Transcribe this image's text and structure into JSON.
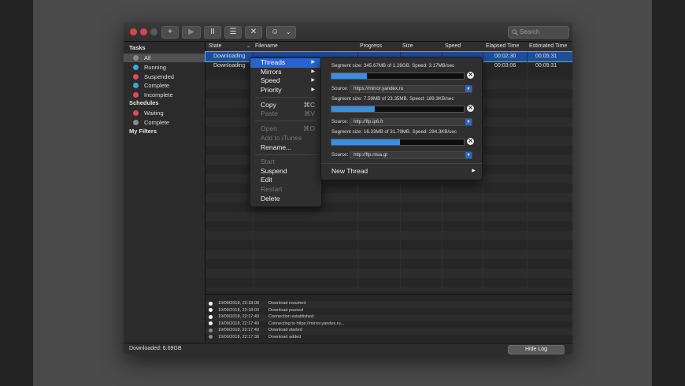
{
  "toolbar": {
    "add_label": "+",
    "play_label": "▶",
    "pause_label": "II",
    "list_label": "☰",
    "delete_label": "✕",
    "speed_label": "☺",
    "speed_arrow": "⌄",
    "search_placeholder": "Search"
  },
  "sidebar": {
    "tasks_heading": "Tasks",
    "tasks": [
      {
        "label": "All",
        "color": "#8a8a8a"
      },
      {
        "label": "Running",
        "color": "#3aa5e6"
      },
      {
        "label": "Suspended",
        "color": "#e04a5a"
      },
      {
        "label": "Complete",
        "color": "#3aa5e6"
      },
      {
        "label": "Incomplete",
        "color": "#e04a5a"
      }
    ],
    "schedules_heading": "Schedules",
    "schedules": [
      {
        "label": "Waiting",
        "color": "#e04a5a"
      },
      {
        "label": "Complete",
        "color": "#8a8a8a"
      }
    ],
    "filters_heading": "My Filters"
  },
  "table": {
    "columns": [
      "State",
      "Filename",
      "Progress",
      "Size",
      "Speed",
      "Elapsed Time",
      "Estimated Time"
    ],
    "rows": [
      {
        "state": "Downloading",
        "elapsed": "00:02:30",
        "estimated": "00:05:31"
      },
      {
        "state": "Downloading",
        "elapsed": "00:03:06",
        "estimated": "00:09:31"
      }
    ]
  },
  "context_menu": {
    "items": [
      {
        "label": "Threads",
        "arrow": "▶"
      },
      {
        "label": "Mirrors",
        "arrow": "▶"
      },
      {
        "label": "Speed",
        "arrow": "▶"
      },
      {
        "label": "Priority",
        "arrow": "▶"
      },
      {
        "label": "Copy",
        "shortcut": "⌘C"
      },
      {
        "label": "Paste",
        "shortcut": "⌘V"
      },
      {
        "label": "Open",
        "shortcut": "⌘O"
      },
      {
        "label": "Add to iTunes"
      },
      {
        "label": "Rename..."
      },
      {
        "label": "Start"
      },
      {
        "label": "Suspend"
      },
      {
        "label": "Edit"
      },
      {
        "label": "Restart"
      },
      {
        "label": "Delete"
      }
    ]
  },
  "threads_submenu": {
    "source_label": "Source:",
    "close_glyph": "✕",
    "dropdown_glyph": "▼",
    "segments": [
      {
        "text": "Segment size: 345.67MB of 1.28GB. Speed: 3.17MB/sec",
        "progress": 0.27,
        "source": "https://mirror.yandex.ru"
      },
      {
        "text": "Segment size: 7.59MB of 23.35MB. Speed: 189.3KB/sec",
        "progress": 0.33,
        "source": "http://ftp.ip6.fr"
      },
      {
        "text": "Segment size: 16.33MB of 31.79MB. Speed: 294.3KB/sec",
        "progress": 0.52,
        "source": "http://ftp.ntua.gr"
      }
    ],
    "new_thread_label": "New Thread",
    "new_thread_arrow": "▶"
  },
  "log": [
    {
      "time": "19/09/2018, 22:18:08",
      "message": "Download resumed",
      "color": "#ffffff"
    },
    {
      "time": "19/09/2018, 22:18:00",
      "message": "Download paused",
      "color": "#ffffff"
    },
    {
      "time": "19/09/2018, 22:17:40",
      "message": "Connection established.",
      "color": "#ffffff"
    },
    {
      "time": "19/09/2018, 22:17:40",
      "message": "Connecting to https://mirror.yandex.ru...",
      "color": "#ffffff"
    },
    {
      "time": "19/09/2018, 22:17:40",
      "message": "Download started",
      "color": "#8a8a8a"
    },
    {
      "time": "19/09/2018, 22:17:38",
      "message": "Download added",
      "color": "#8a8a8a"
    }
  ],
  "status": {
    "downloaded": "Downloaded: 6.69GB",
    "hide_log_label": "Hide Log"
  }
}
